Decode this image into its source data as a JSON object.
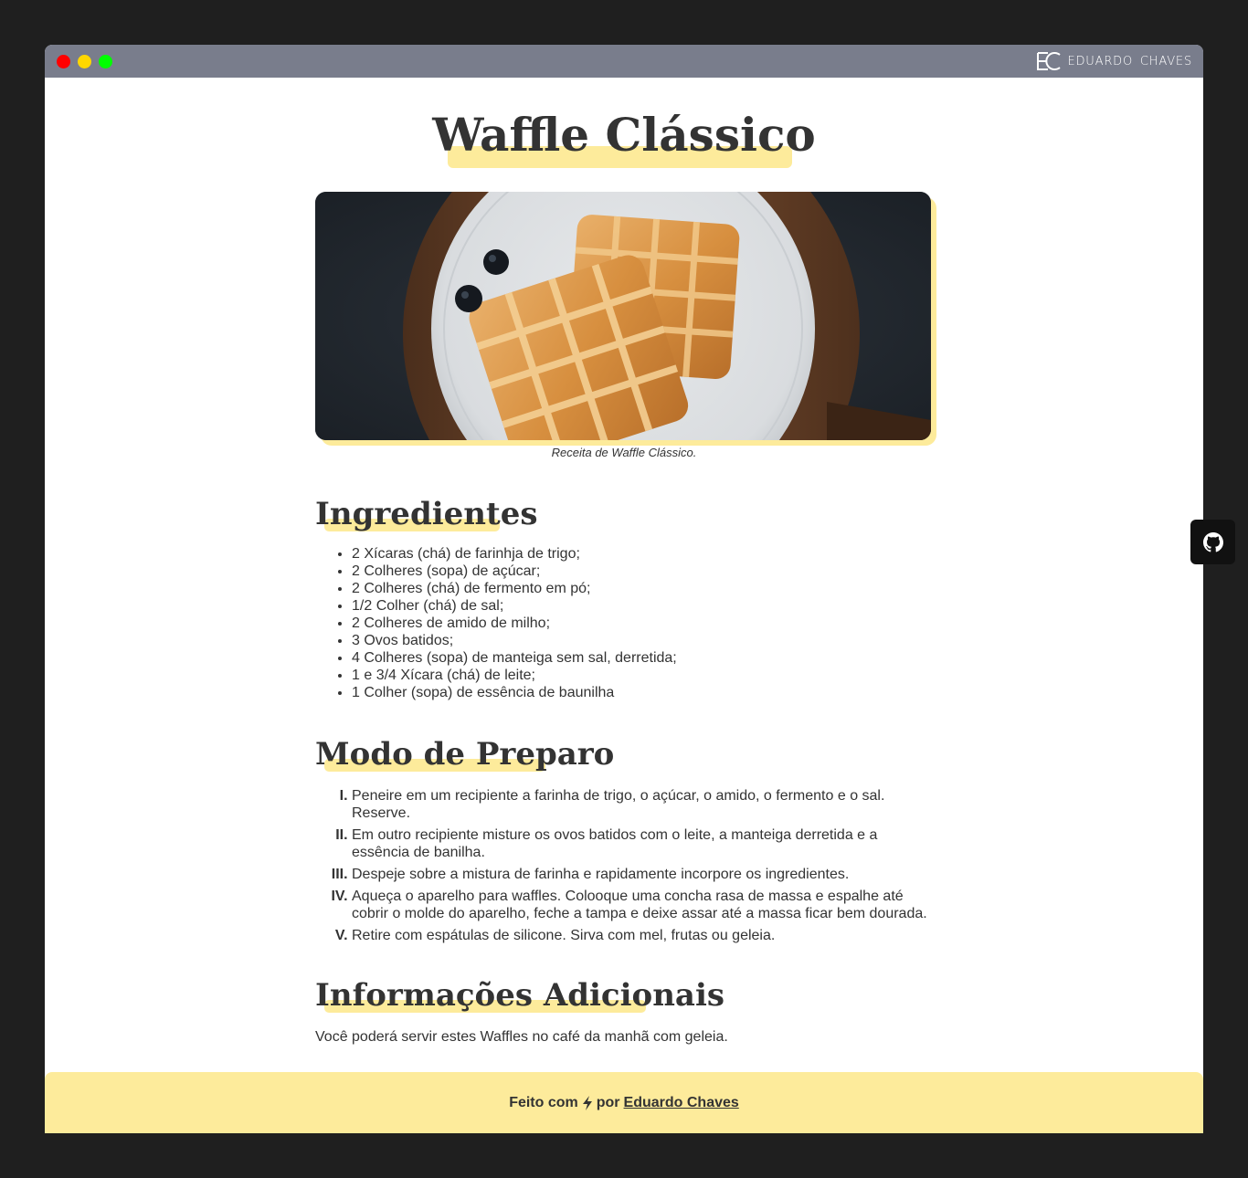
{
  "window": {
    "controls": [
      "close",
      "minimize",
      "maximize"
    ],
    "brand": {
      "text": "EDUARDO  CHAVES",
      "logo_icon": "ec-monogram-icon"
    }
  },
  "page": {
    "title": "Waffle Clássico",
    "image": {
      "subject": "two waffles with blueberries on a white plate",
      "caption": "Receita de Waffle Clássico."
    },
    "ingredients": {
      "heading": "Ingredientes",
      "items": [
        "2 Xícaras (chá) de farinhja de trigo;",
        "2 Colheres (sopa) de açúcar;",
        "2 Colheres (chá) de fermento em pó;",
        "1/2 Colher (chá) de sal;",
        "2 Colheres de amido de milho;",
        "3 Ovos batidos;",
        "4 Colheres (sopa) de manteiga sem sal, derretida;",
        "1 e 3/4 Xícara (chá) de leite;",
        "1 Colher (sopa) de essência de baunilha"
      ]
    },
    "steps": {
      "heading": "Modo de Preparo",
      "items": [
        "Peneire em um recipiente a farinha de trigo, o açúcar, o amido, o fermento e o sal. Reserve.",
        "Em outro recipiente misture os ovos batidos com o leite, a manteiga derretida e a essência de banilha.",
        "Despeje sobre a mistura de farinha e rapidamente incorpore os ingredientes.",
        "Aqueça o aparelho para waffles. Colooque uma concha rasa de massa e espalhe até cobrir o molde do aparelho, feche a tampa e deixe assar até a massa ficar bem dourada.",
        "Retire com espátulas de silicone. Sirva com mel, frutas ou geleia."
      ]
    },
    "info": {
      "heading": "Informações Adicionais",
      "text": "Você poderá servir estes Waffles no café da manhã com geleia."
    }
  },
  "footer": {
    "prefix": "Feito com",
    "icon": "lightning-bolt-icon",
    "middle": "por",
    "author_link": "Eduardo Chaves"
  },
  "floating": {
    "github_icon": "github-icon"
  },
  "colors": {
    "background": "#1f1f1f",
    "titlebar": "#797d8c",
    "accent": "#fdeb9b",
    "text": "#333333"
  }
}
